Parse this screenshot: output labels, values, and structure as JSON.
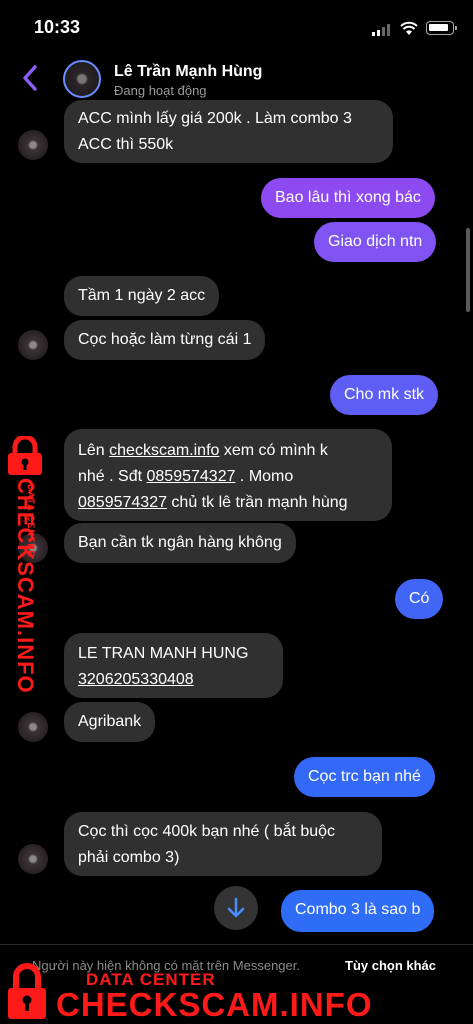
{
  "status_bar": {
    "time": "10:33"
  },
  "header": {
    "name": "Lê Trần Mạnh Hùng",
    "status": "Đang hoạt động"
  },
  "messages": [
    {
      "dir": "in",
      "lines": [
        "ACC mình lấy giá 200k . Làm combo 3",
        "ACC thì 550k"
      ]
    },
    {
      "dir": "out",
      "text": "Bao lâu thì xong bác"
    },
    {
      "dir": "out",
      "text": "Giao dịch ntn"
    },
    {
      "dir": "in",
      "text": "Tầm 1 ngày 2 acc"
    },
    {
      "dir": "in",
      "text": "Cọc hoặc làm từng cái 1"
    },
    {
      "dir": "out",
      "text": "Cho mk stk"
    },
    {
      "dir": "in",
      "parts": {
        "p1": "Lên ",
        "link": "checkscam.info",
        "p2": " xem có mình k",
        "p3": "nhé . Sđt ",
        "phone": "0859574327",
        "p4": " . Momo",
        "phone2": "0859574327",
        "p5": " chủ tk lê trần mạnh hùng"
      }
    },
    {
      "dir": "in",
      "text": "Bạn cần tk ngân hàng không"
    },
    {
      "dir": "out",
      "text": "Có"
    },
    {
      "dir": "in",
      "line1": "LE TRAN MANH HUNG",
      "account": "3206205330408"
    },
    {
      "dir": "in",
      "text": "Agribank"
    },
    {
      "dir": "out",
      "text": "Cọc trc bạn nhé"
    },
    {
      "dir": "in",
      "lines": [
        "Cọc thì cọc 400k bạn nhé ( bắt buộc",
        "phải combo 3)"
      ]
    },
    {
      "dir": "out",
      "text": "Combo 3 là sao b"
    }
  ],
  "footer": {
    "note": "Người này hiện không có mặt trên Messenger.",
    "action": "Tùy chọn khác"
  },
  "watermark": {
    "brand": "CHECKSCAM.INFO",
    "sub": "DATA CENTER"
  },
  "colors": {
    "accent": "#8b5cf6",
    "out_top": "#8b4cf0",
    "out_bottom": "#2f6df6",
    "in_bubble": "#303030",
    "watermark": "#ff1a1a"
  },
  "icons": {
    "back": "chevron-left-icon",
    "scroll": "arrow-down-icon",
    "lock": "lock-icon"
  }
}
